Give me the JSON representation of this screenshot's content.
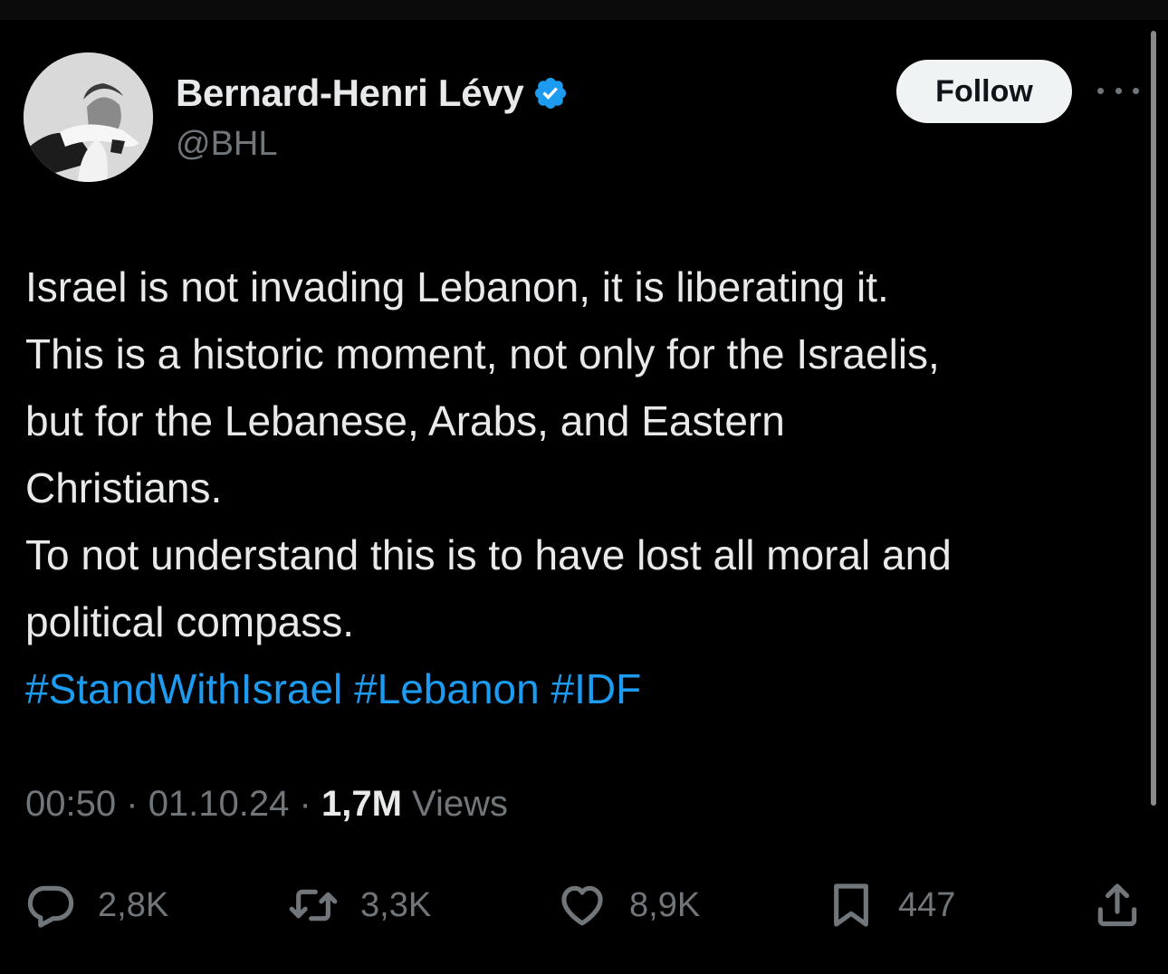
{
  "author": {
    "display_name": "Bernard-Henri Lévy",
    "handle": "@BHL",
    "verified": true
  },
  "follow_label": "Follow",
  "tweet": {
    "lines": [
      "Israel is not invading Lebanon, it is liberating it.",
      "This is a historic moment, not only for the Israelis,",
      "but for the Lebanese, Arabs, and Eastern",
      "Christians.",
      "To not understand this is to have lost all moral and",
      "political compass."
    ],
    "hashtags": [
      "#StandWithIsrael",
      "#Lebanon",
      "#IDF"
    ]
  },
  "meta": {
    "time": "00:50",
    "date": "01.10.24",
    "separator": "·",
    "views_count": "1,7M",
    "views_label": "Views"
  },
  "actions": {
    "replies": "2,8K",
    "reposts": "3,3K",
    "likes": "8,9K",
    "bookmarks": "447"
  },
  "colors": {
    "background": "#000000",
    "text": "#e7e9ea",
    "secondary": "#71767b",
    "hashtag": "#1d9bf0",
    "verified": "#1d9bf0"
  }
}
